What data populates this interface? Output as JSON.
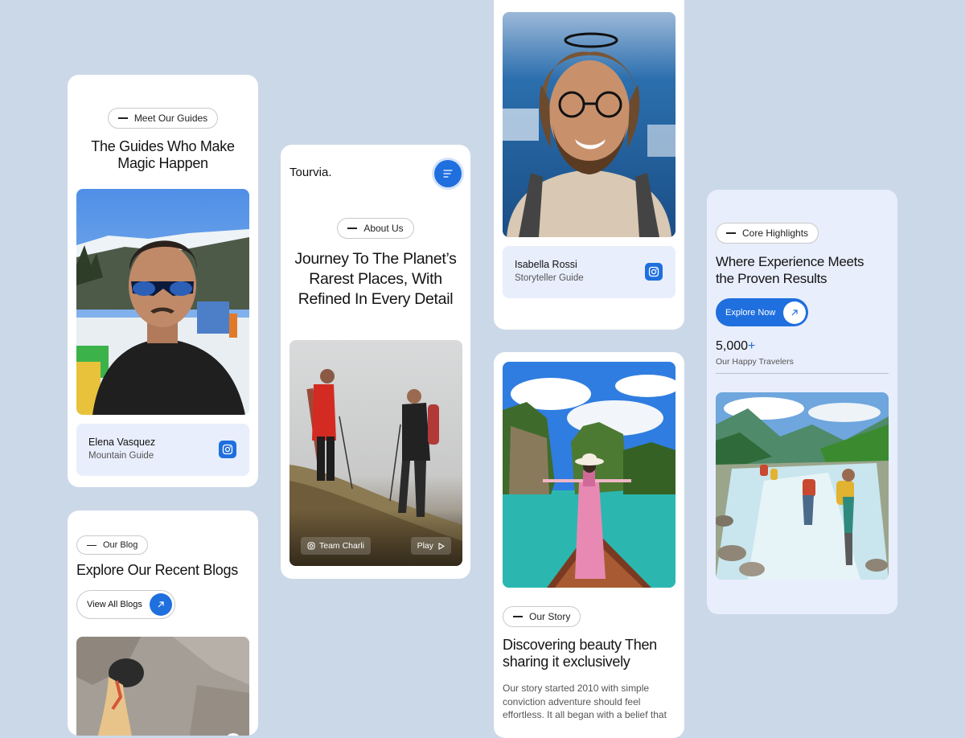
{
  "guides_card": {
    "tag": "Meet Our Guides",
    "title_line1": "The Guides Who Make",
    "title_line2": "Magic Happen",
    "guide": {
      "name": "Elena Vasquez",
      "role": "Mountain Guide"
    }
  },
  "blog_card": {
    "tag": "Our Blog",
    "title": "Explore Our Recent Blogs",
    "button_label": "View All Blogs"
  },
  "about_card": {
    "brand": "Tourvia.",
    "tag": "About Us",
    "title_line1": "Journey To The Planet’s",
    "title_line2": "Rarest Places, With",
    "title_line3": "Refined In Every Detail",
    "video_tag": "Team Charli",
    "play_label": "Play"
  },
  "guide2_card": {
    "name": "Isabella Rossi",
    "role": "Storyteller Guide"
  },
  "story_card": {
    "tag": "Our Story",
    "title_line1": "Discovering beauty Then",
    "title_line2": "sharing it exclusively",
    "body_line1": "Our story started 2010 with simple",
    "body_line2": "conviction adventure should feel",
    "body_line3": "effortless. It all began with a belief that"
  },
  "highlights_card": {
    "tag": "Core Highlights",
    "title_line1": "Where Experience Meets",
    "title_line2": "the Proven Results",
    "button_label": "Explore Now",
    "stat_value": "5,000",
    "stat_suffix": "+",
    "stat_label": "Our Happy Travelers"
  },
  "colors": {
    "accent": "#1f6fde",
    "background": "#cbd8e8",
    "soft_panel": "#e8eefb"
  }
}
